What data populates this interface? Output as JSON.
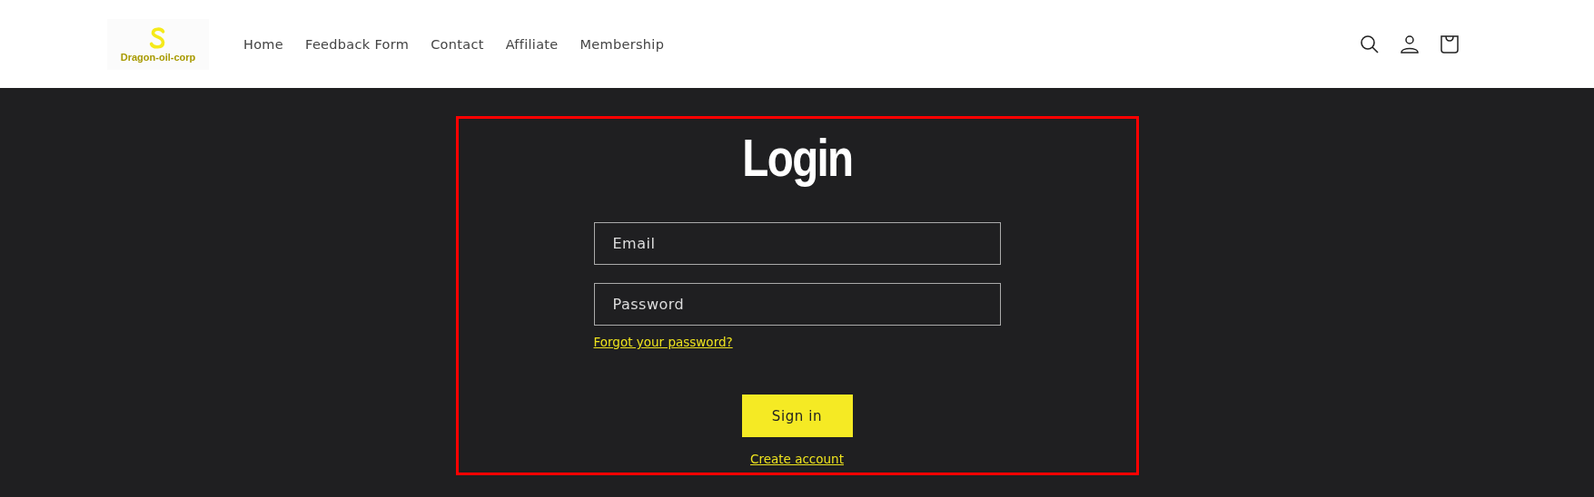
{
  "header": {
    "logo_text": "Dragon-oil-corp",
    "nav": [
      {
        "label": "Home"
      },
      {
        "label": "Feedback Form"
      },
      {
        "label": "Contact"
      },
      {
        "label": "Affiliate"
      },
      {
        "label": "Membership"
      }
    ]
  },
  "login": {
    "title": "Login",
    "fields": [
      {
        "placeholder": "Email"
      },
      {
        "placeholder": "Password"
      }
    ],
    "forgot_link": "Forgot your password?",
    "submit": "Sign in",
    "create_link": "Create account"
  }
}
